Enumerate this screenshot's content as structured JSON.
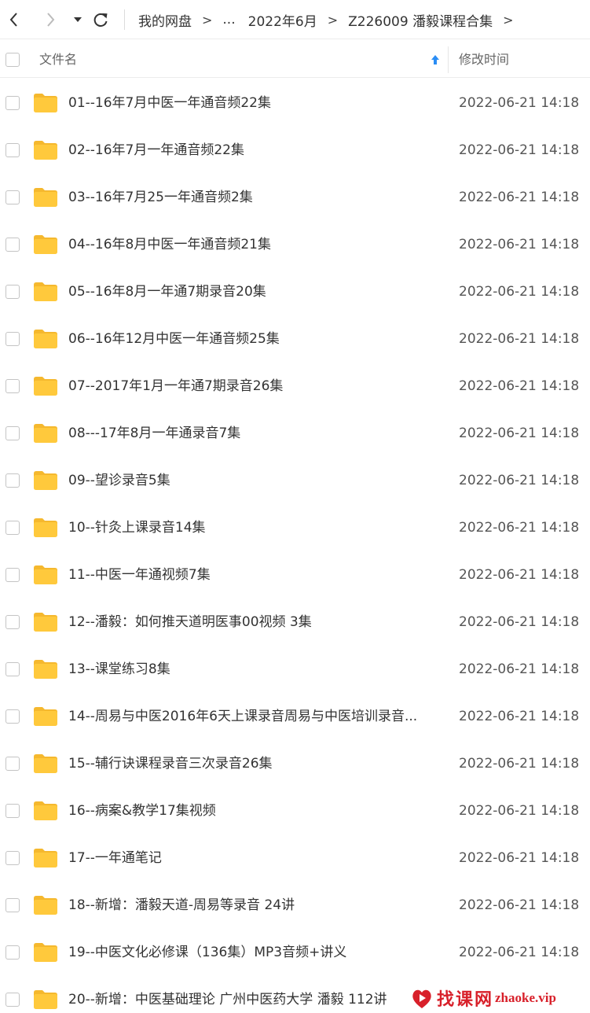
{
  "breadcrumb": {
    "items": [
      "我的网盘",
      "...",
      "2022年6月",
      "Z226009 潘毅课程合集"
    ],
    "separator": ">"
  },
  "header": {
    "name_label": "文件名",
    "time_label": "修改时间"
  },
  "files": [
    {
      "name": "01--16年7月中医一年通音频22集",
      "date": "2022-06-21 14:18"
    },
    {
      "name": "02--16年7月一年通音频22集",
      "date": "2022-06-21 14:18"
    },
    {
      "name": "03--16年7月25一年通音频2集",
      "date": "2022-06-21 14:18"
    },
    {
      "name": "04--16年8月中医一年通音频21集",
      "date": "2022-06-21 14:18"
    },
    {
      "name": "05--16年8月一年通7期录音20集",
      "date": "2022-06-21 14:18"
    },
    {
      "name": "06--16年12月中医一年通音频25集",
      "date": "2022-06-21 14:18"
    },
    {
      "name": "07--2017年1月一年通7期录音26集",
      "date": "2022-06-21 14:18"
    },
    {
      "name": "08---17年8月一年通录音7集",
      "date": "2022-06-21 14:18"
    },
    {
      "name": "09--望诊录音5集",
      "date": "2022-06-21 14:18"
    },
    {
      "name": "10--针灸上课录音14集",
      "date": "2022-06-21 14:18"
    },
    {
      "name": "11--中医一年通视频7集",
      "date": "2022-06-21 14:18"
    },
    {
      "name": "12--潘毅：如何推天道明医事00视频 3集",
      "date": "2022-06-21 14:18"
    },
    {
      "name": "13--课堂练习8集",
      "date": "2022-06-21 14:18"
    },
    {
      "name": "14--周易与中医2016年6天上课录音周易与中医培训录音...",
      "date": "2022-06-21 14:18"
    },
    {
      "name": "15--辅行诀课程录音三次录音26集",
      "date": "2022-06-21 14:18"
    },
    {
      "name": "16--病案&教学17集视频",
      "date": "2022-06-21 14:18"
    },
    {
      "name": "17--一年通笔记",
      "date": "2022-06-21 14:18"
    },
    {
      "name": "18--新增：潘毅天道-周易等录音 24讲",
      "date": "2022-06-21 14:18"
    },
    {
      "name": "19--中医文化必修课（136集）MP3音频+讲义",
      "date": "2022-06-21 14:18"
    },
    {
      "name": "20--新增：中医基础理论 广州中医药大学 潘毅 112讲",
      "date": ""
    }
  ],
  "watermark": {
    "text": "找课网",
    "url": "zhaoke.vip"
  },
  "colors": {
    "folder": "#FFC93C",
    "folder_back": "#F5B82E",
    "sort_arrow": "#2A8DF5",
    "watermark": "#D8202A"
  }
}
